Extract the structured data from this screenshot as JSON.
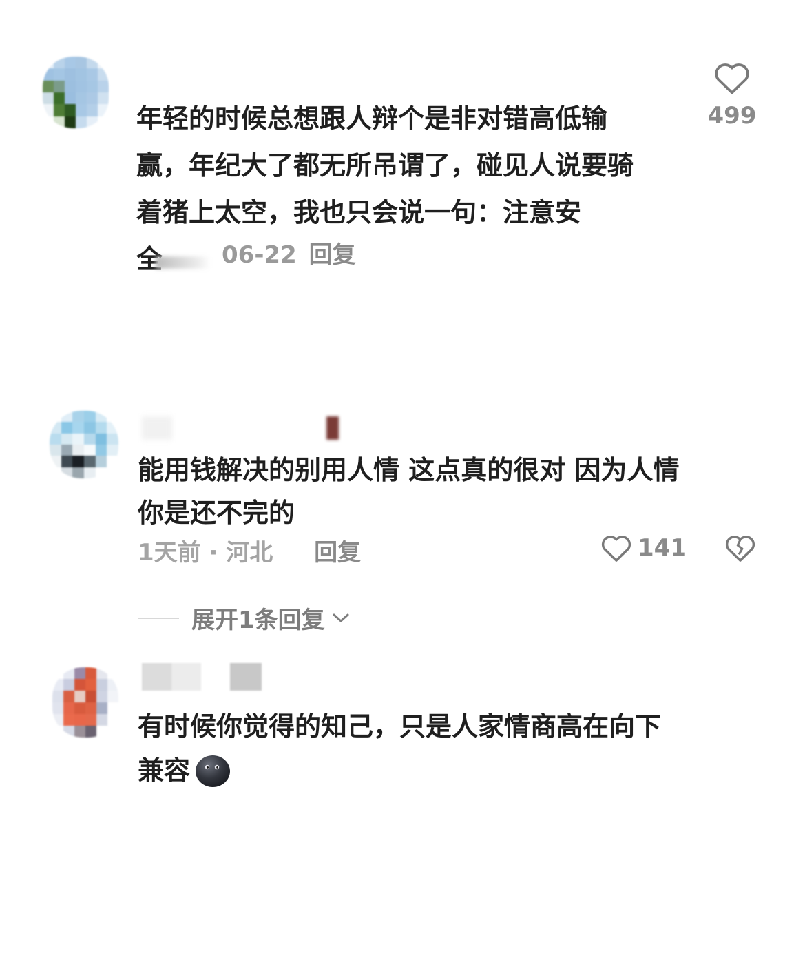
{
  "comments": [
    {
      "text_lines": [
        "年轻的时候总想跟人辩个是非对错高低输",
        "赢，年纪大了都无所吊谓了，碰见人说要骑",
        "着猪上太空，我也只会说一句：注意安"
      ],
      "last_char": "全",
      "date": "06-22",
      "reply": "回复",
      "likes": "499"
    },
    {
      "text_lines": [
        "能用钱解决的别用人情 这点真的很对 因为人情",
        "你是还不完的"
      ],
      "time": "1天前",
      "separator": "·",
      "location": "河北",
      "reply": "回复",
      "likes": "141",
      "expand": "展开1条回复"
    },
    {
      "text_lines": [
        "有时候你觉得的知己，只是人家情商高在向下"
      ],
      "last_line": "兼容"
    }
  ],
  "icons": {
    "like": "heart-outline-icon",
    "dislike": "broken-heart-icon",
    "expand": "chevron-down-icon",
    "emoji": "dark-face-emoji-icon"
  }
}
